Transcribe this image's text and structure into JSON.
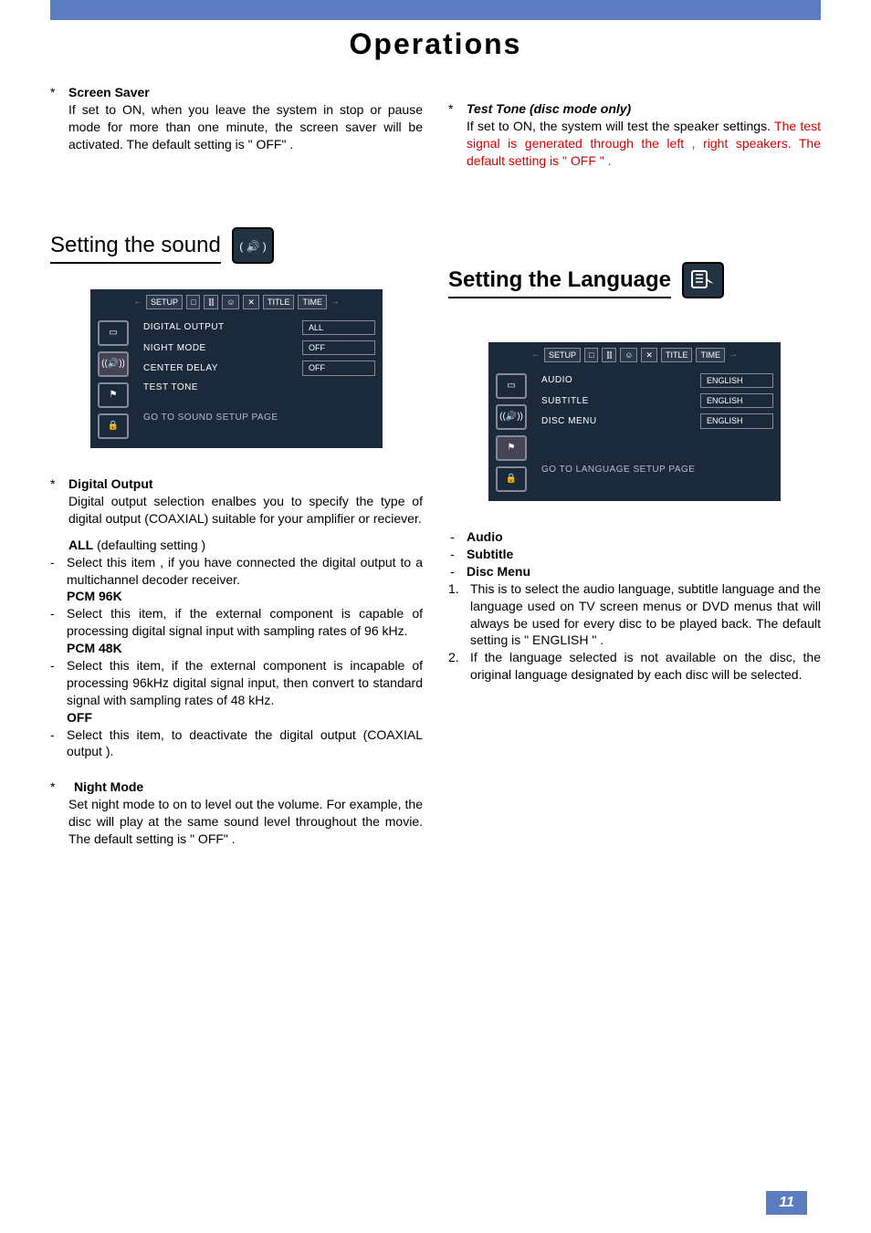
{
  "page_title": "Operations",
  "page_number": "11",
  "left": {
    "screen_saver": {
      "heading": "Screen Saver",
      "body": "If set to ON, when you leave the system in stop or pause mode for more than one minute, the screen saver will be activated. The default setting is \" OFF\" ."
    },
    "sound_heading": "Setting the sound",
    "osd": {
      "tabs": [
        "SETUP",
        "□",
        "⫿⫿",
        "☺",
        "✕",
        "TITLE",
        "TIME"
      ],
      "rows": [
        {
          "label": "DIGITAL  OUTPUT",
          "val": "ALL"
        },
        {
          "label": "NIGHT MODE",
          "val": "OFF"
        },
        {
          "label": "CENTER DELAY",
          "val": "OFF"
        },
        {
          "label": "TEST  TONE",
          "val": ""
        }
      ],
      "footer": "GO TO SOUND SETUP PAGE"
    },
    "digital_output": {
      "heading": "Digital Output",
      "intro": "Digital output selection enalbes you to specify the type of digital output (COAXIAL) suitable for your amplifier or reciever.",
      "all_label": "ALL",
      "all_suffix": " (defaulting setting )",
      "all_body": "Select this item , if you have connected the digital output to a multichannel decoder receiver.",
      "pcm96_label": "PCM 96K",
      "pcm96_body": "Select this item, if the external component is capable of processing digital signal input with sampling rates of 96 kHz.",
      "pcm48_label": "PCM 48K",
      "pcm48_body": "Select this item, if the external component is incapable of processing 96kHz digital signal input, then convert to standard signal with sampling rates of 48 kHz.",
      "off_label": "OFF",
      "off_body": "Select this item,  to deactivate the digital output (COAXIAL  output )."
    },
    "night_mode": {
      "heading": "Night Mode",
      "body": "Set night mode to on to level out the volume. For example, the disc will play at the same sound level throughout the movie. The default setting is \" OFF\" ."
    }
  },
  "right": {
    "test_tone": {
      "heading": "Test Tone (disc mode only)",
      "line1": "If set to ON, the system will test the speaker settings. ",
      "red": "The test signal is generated through the left , right speakers. The default setting is \" OFF \" ."
    },
    "lang_heading": "Setting the Language",
    "osd": {
      "tabs": [
        "SETUP",
        "□",
        "⫿⫿",
        "☺",
        "✕",
        "TITLE",
        "TIME"
      ],
      "rows": [
        {
          "label": "AUDIO",
          "val": "ENGLISH"
        },
        {
          "label": "SUBTITLE",
          "val": "ENGLISH"
        },
        {
          "label": "DISC MENU",
          "val": "ENGLISH"
        }
      ],
      "footer": "GO TO LANGUAGE SETUP PAGE"
    },
    "list": {
      "items": [
        "Audio",
        "Subtitle",
        "Disc Menu"
      ],
      "num1": "This is to select the audio language, subtitle language and the language used on TV screen menus or DVD menus that will always be used for every disc to be played back. The default setting is \" ENGLISH \" .",
      "num2": "If the language selected is not available on the disc, the original language designated by each disc will be selected."
    }
  }
}
